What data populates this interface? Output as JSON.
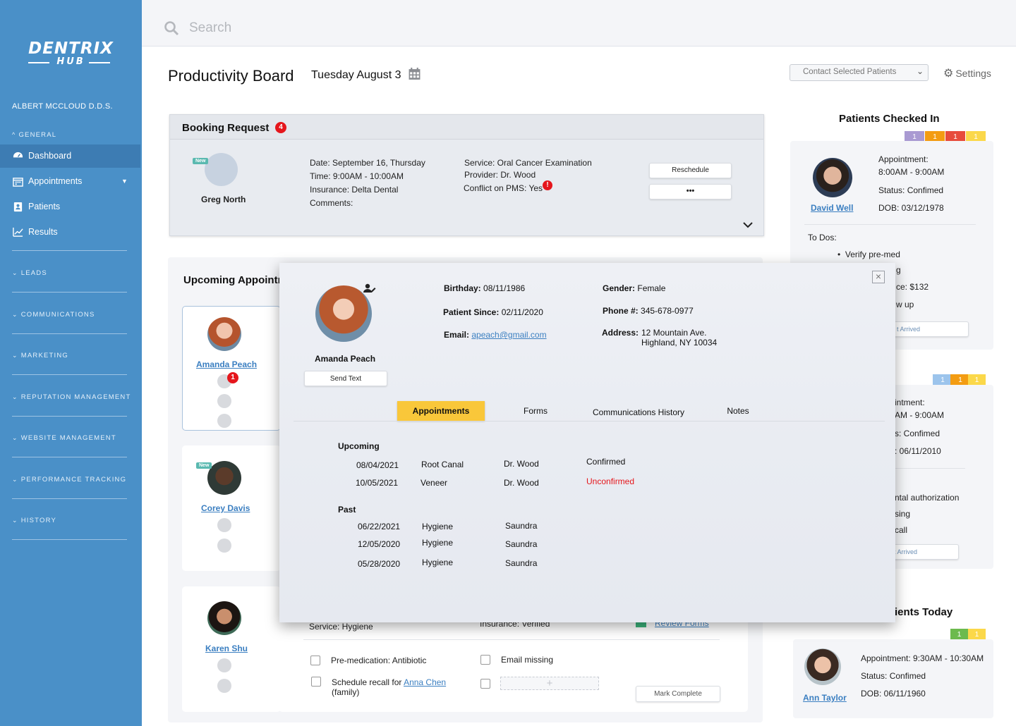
{
  "brand": {
    "name": "DENTRIX",
    "sub": "HUB"
  },
  "sidebar": {
    "doctor": "ALBERT MCCLOUD D.D.S.",
    "general": "GENERAL",
    "items": [
      {
        "label": "Dashboard",
        "icon": "dashboard-icon"
      },
      {
        "label": "Appointments",
        "icon": "calendar-icon"
      },
      {
        "label": "Patients",
        "icon": "patients-icon"
      },
      {
        "label": "Results",
        "icon": "chart-icon"
      }
    ],
    "sections": [
      "LEADS",
      "COMMUNICATIONS",
      "MARKETING",
      "REPUTATION MANAGEMENT",
      "WEBSITE MANAGEMENT",
      "PERFORMANCE TRACKING",
      "HISTORY"
    ]
  },
  "search": {
    "placeholder": "Search"
  },
  "header": {
    "title": "Productivity Board",
    "date": "Tuesday August 3",
    "contact_select": "Contact Selected Patients",
    "settings": "Settings"
  },
  "booking": {
    "title": "Booking Request",
    "count": "4",
    "new_tag": "New",
    "patient": "Greg North",
    "date": "Date: September 16, Thursday",
    "time": "Time: 9:00AM - 10:00AM",
    "insurance": "Insurance: Delta Dental",
    "comments": "Comments:",
    "service": "Service: Oral Cancer Examination",
    "provider": "Provider: Dr. Wood",
    "conflict": "Conflict on PMS: Yes",
    "reschedule": "Reschedule",
    "more": "•••"
  },
  "upcoming": {
    "title": "Upcoming Appointments",
    "patients": [
      {
        "name": "Amanda Peach",
        "badge": "1"
      },
      {
        "name": "Corey Davis",
        "tag": "New"
      },
      {
        "name": "Karen Shu"
      }
    ],
    "service": "Service: Hygiene",
    "insurance": "Insurance: Verified",
    "review_forms": "Review Forms",
    "tasks": [
      "Pre-medication: Antibiotic",
      "Email missing"
    ],
    "recall_prefix": "Schedule recall for",
    "recall_link": "Anna Chen",
    "recall_suffix": "(family)",
    "mark_complete": "Mark Complete"
  },
  "checked_in": {
    "title": "Patients Checked In",
    "chips": [
      "1",
      "1",
      "1",
      "1"
    ],
    "patient": {
      "name": "David Well",
      "appointment_label": "Appointment:",
      "time": "8:00AM - 9:00AM",
      "status": "Status: Confimed",
      "dob": "DOB: 03/12/1978"
    },
    "todos_label": "To Dos:",
    "todo1": "Verify pre-med",
    "todo2_frag": "g",
    "balance_frag": "ce: $132",
    "follow_frag": "w up",
    "arrived_frag": "t Arrived"
  },
  "second": {
    "chips": [
      "1",
      "1",
      "1"
    ],
    "appt_frag": "intment:",
    "time_frag": "AM - 9:00AM",
    "status_frag": "s: Confimed",
    "dob_frag": ": 06/11/2010",
    "t1": "ntal authorization",
    "t2": "sing",
    "t3": "call",
    "arrived_frag": "t Arrived"
  },
  "today": {
    "title_frag": "ients Today",
    "chips": [
      "1",
      "1"
    ],
    "patient": {
      "name": "Ann Taylor",
      "appointment": "Appointment: 9:30AM - 10:30AM",
      "status": "Status: Confimed",
      "dob": "DOB: 06/11/1960"
    }
  },
  "modal": {
    "name": "Amanda Peach",
    "send_text": "Send Text",
    "birthday_label": "Birthday:",
    "birthday": "08/11/1986",
    "since_label": "Patient Since:",
    "since": "02/11/2020",
    "email_label": "Email:",
    "email": "apeach@gmail.com",
    "gender_label": "Gender:",
    "gender": "Female",
    "phone_label": "Phone #:",
    "phone": "345-678-0977",
    "address_label": "Address:",
    "address1": "12 Mountain Ave.",
    "address2": "Highland, NY 10034",
    "tabs": [
      "Appointments",
      "Forms",
      "Communications History",
      "Notes"
    ],
    "upcoming_label": "Upcoming",
    "upcoming": [
      {
        "date": "08/04/2021",
        "proc": "Root Canal",
        "provider": "Dr. Wood",
        "status": "Confirmed"
      },
      {
        "date": "10/05/2021",
        "proc": "Veneer",
        "provider": "Dr. Wood",
        "status": "Unconfirmed"
      }
    ],
    "past_label": "Past",
    "past": [
      {
        "date": "06/22/2021",
        "proc": "Hygiene",
        "provider": "Saundra"
      },
      {
        "date": "12/05/2020",
        "proc": "Hygiene",
        "provider": "Saundra"
      },
      {
        "date": "05/28/2020",
        "proc": "Hygiene",
        "provider": "Saundra"
      }
    ],
    "colors": {
      "confirmed": "#222222",
      "unconfirmed": "#e5161c",
      "tab_active": "#f9c73a"
    }
  }
}
